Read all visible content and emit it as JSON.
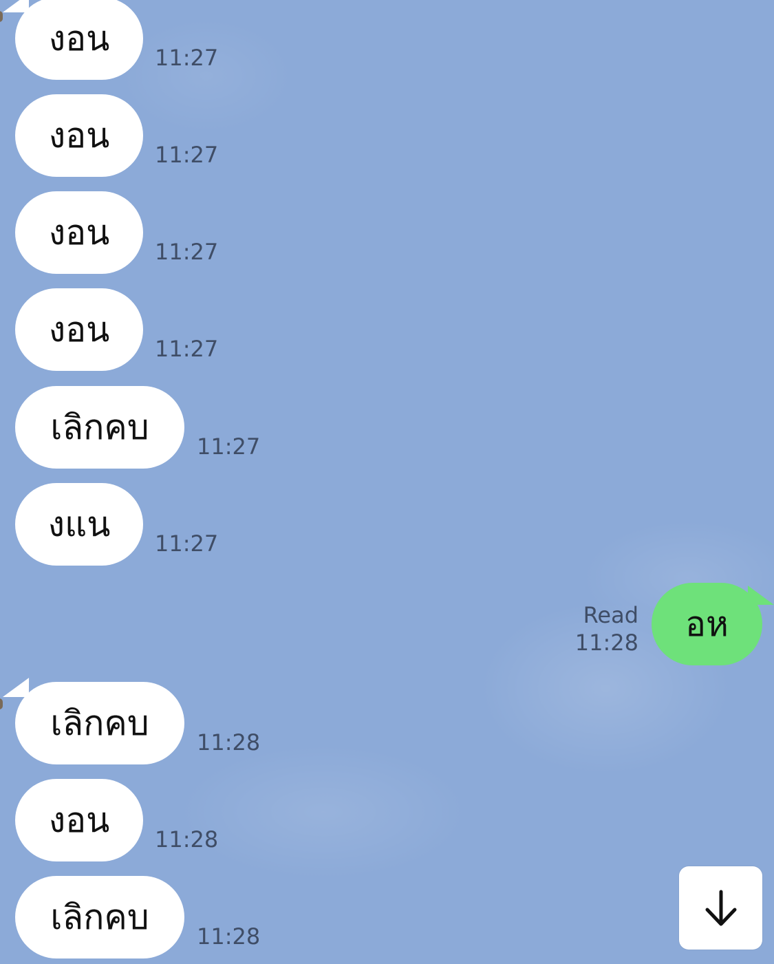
{
  "messages": [
    {
      "side": "in",
      "text": "งอน",
      "time": "11:27"
    },
    {
      "side": "in",
      "text": "งอน",
      "time": "11:27"
    },
    {
      "side": "in",
      "text": "งอน",
      "time": "11:27"
    },
    {
      "side": "in",
      "text": "งอน",
      "time": "11:27"
    },
    {
      "side": "in",
      "text": "เลิกคบ",
      "time": "11:27"
    },
    {
      "side": "in",
      "text": "งแน",
      "time": "11:27"
    },
    {
      "side": "out",
      "text": "อห",
      "time": "11:28",
      "status": "Read"
    },
    {
      "side": "in",
      "text": "เลิกคบ",
      "time": "11:28"
    },
    {
      "side": "in",
      "text": "งอน",
      "time": "11:28"
    },
    {
      "side": "in",
      "text": "เลิกคบ",
      "time": "11:28"
    }
  ],
  "scroll_button": {
    "icon": "arrow-down-icon"
  },
  "colors": {
    "background": "#8caad8",
    "incoming_bubble": "#ffffff",
    "outgoing_bubble": "#6ee17a",
    "timestamp": "#3f4d66"
  }
}
